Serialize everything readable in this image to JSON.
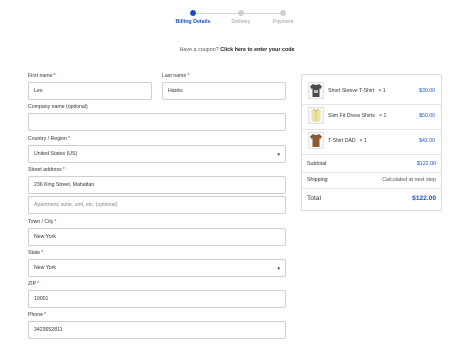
{
  "stepper": {
    "steps": [
      {
        "label": "Billing Details",
        "active": true
      },
      {
        "label": "Delivery",
        "active": false
      },
      {
        "label": "Payment",
        "active": false
      }
    ],
    "accent_color": "#1c4fc4"
  },
  "coupon": {
    "text": "Have a coupon?",
    "link": "Click here to enter your code"
  },
  "form": {
    "first_name": {
      "label": "First name",
      "value": "Leo"
    },
    "last_name": {
      "label": "Last name",
      "value": "Hanks"
    },
    "company": {
      "label": "Company name (optional)",
      "value": ""
    },
    "country": {
      "label": "Country / Region",
      "value": "United States (US)"
    },
    "street": {
      "label": "Street address",
      "value": "236 King Street, Mahattan"
    },
    "apartment": {
      "placeholder": "Apartment, suite, unit, etc. (optional)"
    },
    "city": {
      "label": "Town / City",
      "value": "New York"
    },
    "state": {
      "label": "State",
      "value": "New York"
    },
    "zip": {
      "label": "ZIP",
      "value": "10001"
    },
    "phone": {
      "label": "Phone",
      "value": "3423652811"
    },
    "required_mark": "*"
  },
  "summary": {
    "items": [
      {
        "name": "Short Sleeve T-Shirt",
        "qty": "× 1",
        "price": "$30.00",
        "icon": "tshirt-icon",
        "color": "#4a4a4a"
      },
      {
        "name": "Slim Fit Dress Shirts",
        "qty": "× 1",
        "price": "$50.00",
        "icon": "dress-shirt-icon",
        "color": "#e9d98a"
      },
      {
        "name": "T-Shirt DAD",
        "qty": "× 1",
        "price": "$42.00",
        "icon": "tshirt-icon",
        "color": "#8a5a33"
      }
    ],
    "subtotal": {
      "label": "Subtotal",
      "value": "$122.00"
    },
    "shipping": {
      "label": "Shipping",
      "value": "Calculated at next step"
    },
    "total": {
      "label": "Total",
      "value": "$122.00"
    }
  }
}
